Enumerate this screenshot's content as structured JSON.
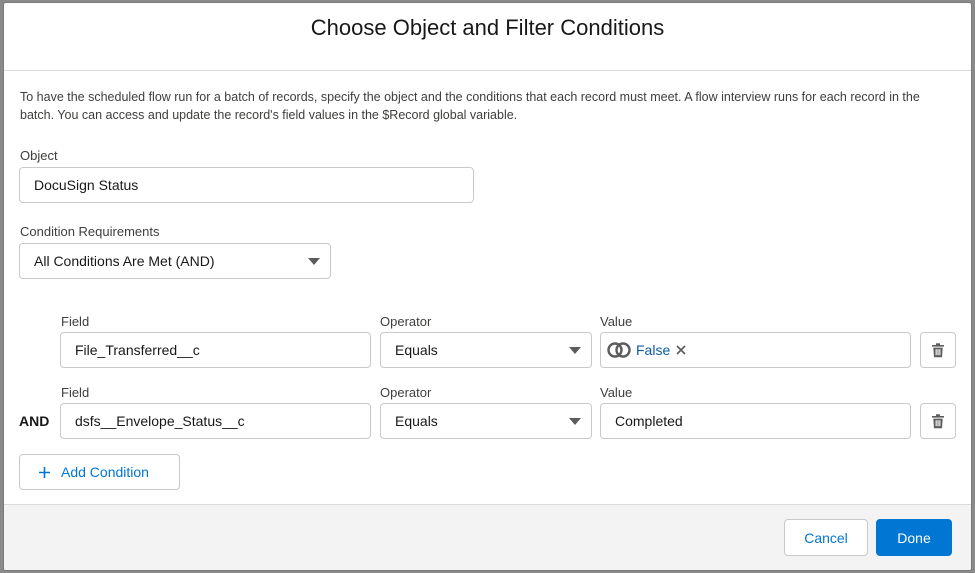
{
  "modal": {
    "title": "Choose Object and Filter Conditions",
    "description": "To have the scheduled flow run for a batch of records, specify the object and the conditions that each record must meet. A flow interview runs for each record in the batch. You can access and update the record's field values in the $Record global variable."
  },
  "object": {
    "label": "Object",
    "value": "DocuSign Status"
  },
  "requirements": {
    "label": "Condition Requirements",
    "value": "All Conditions Are Met (AND)"
  },
  "conditions": [
    {
      "field_label": "Field",
      "field_value": "File_Transferred__c",
      "operator_label": "Operator",
      "operator_value": "Equals",
      "value_label": "Value",
      "value_pill": "False",
      "value_icon": "global-constant-icon"
    },
    {
      "prefix": "AND",
      "field_label": "Field",
      "field_value": "dsfs__Envelope_Status__c",
      "operator_label": "Operator",
      "operator_value": "Equals",
      "value_label": "Value",
      "value_text": "Completed"
    }
  ],
  "add_condition_label": "Add Condition",
  "footer": {
    "cancel_label": "Cancel",
    "done_label": "Done"
  },
  "colors": {
    "brand": "#0176d3",
    "link": "#0b5cab",
    "border": "#c9c9c9",
    "footer_bg": "#f3f3f3"
  }
}
